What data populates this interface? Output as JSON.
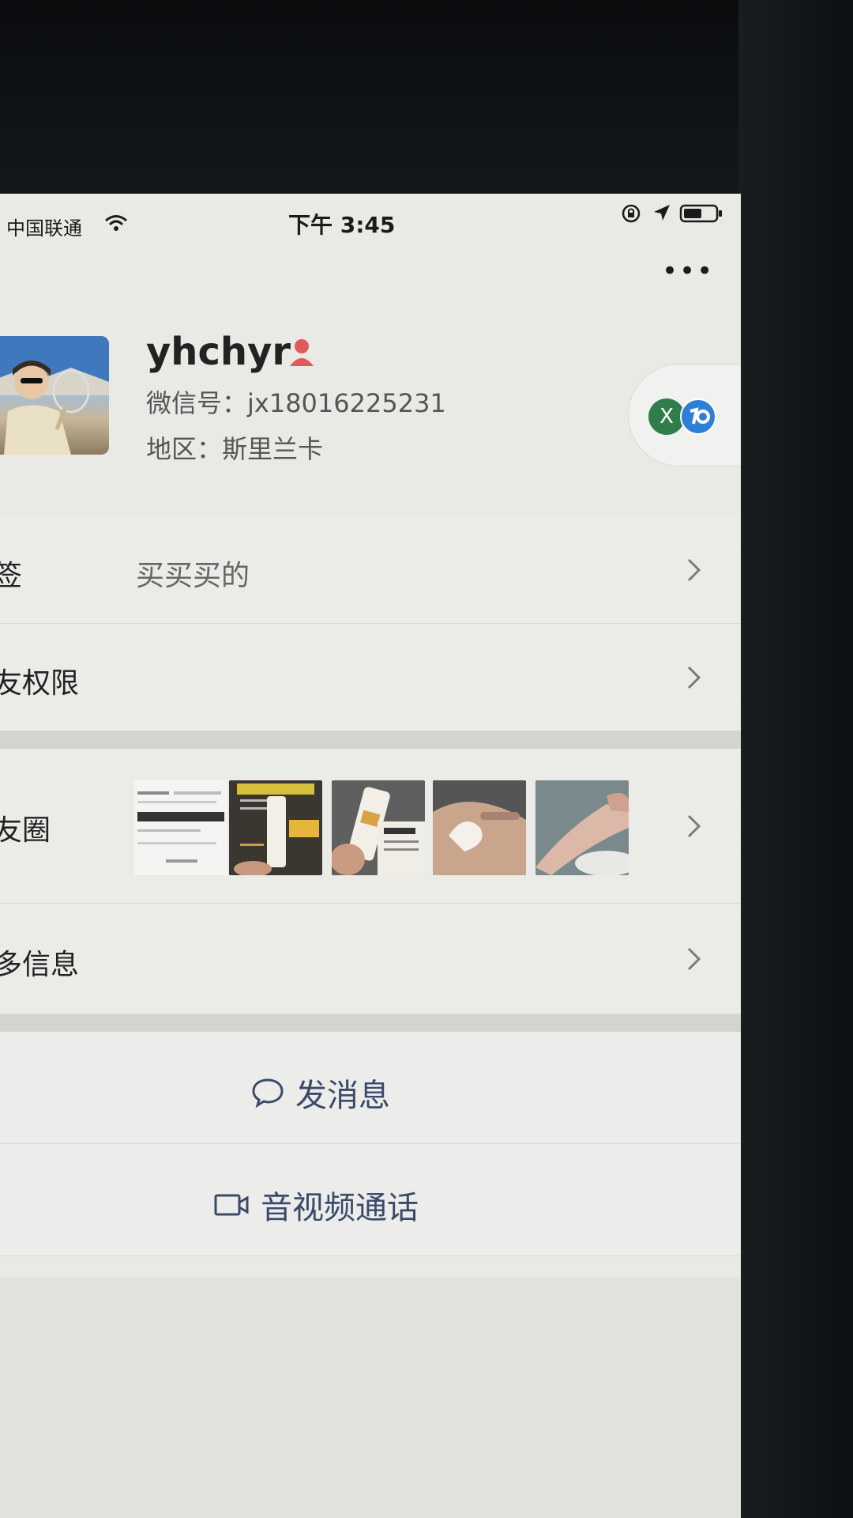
{
  "status_bar": {
    "carrier": "中国联通",
    "time": "下午 3:45"
  },
  "profile": {
    "nickname": "yhchyr",
    "wechat_id": "微信号：jx18016225231",
    "region": "地区：斯里兰卡",
    "gender_icon": "female-icon",
    "status_icons": [
      "x-status-icon",
      "app-status-icon"
    ]
  },
  "rows": {
    "tag": {
      "label": "签",
      "value": "买买买的"
    },
    "friend_permission": {
      "label": "友权限"
    },
    "moments": {
      "label": "友圈"
    },
    "more_info": {
      "label": "多信息"
    }
  },
  "actions": {
    "message": {
      "label": "发消息",
      "icon": "chat-bubble-icon"
    },
    "call": {
      "label": "音视频通话",
      "icon": "video-camera-icon"
    }
  },
  "colors": {
    "screen_bg": "#e9e9e6",
    "action_text": "#3a4a6a",
    "gender_icon": "#e05a5a",
    "status_green": "#2e7d4a",
    "status_blue": "#2f7fd6"
  }
}
